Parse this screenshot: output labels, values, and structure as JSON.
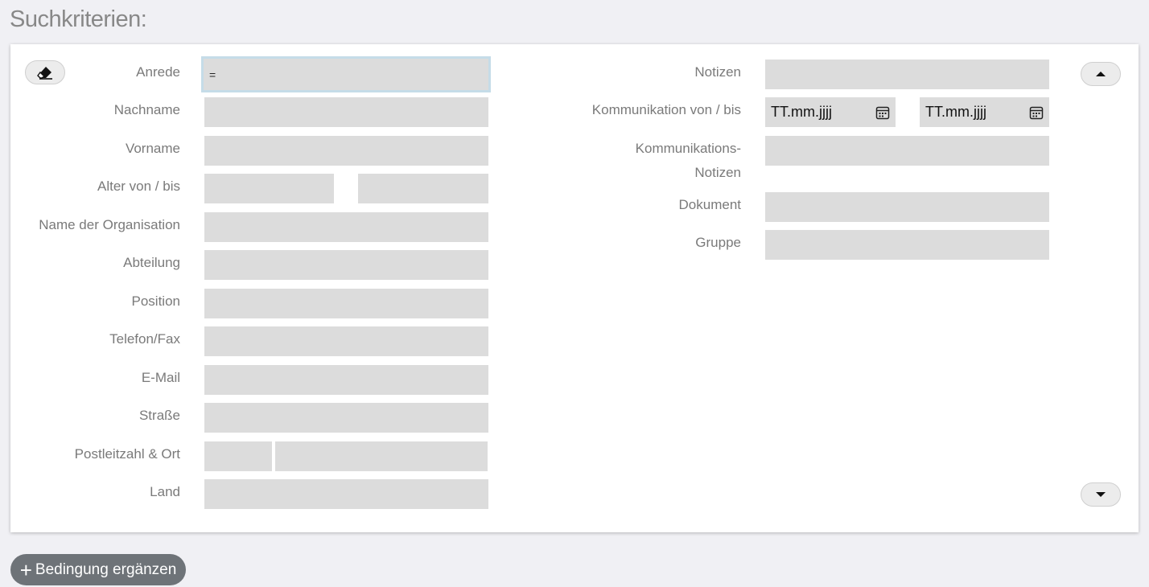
{
  "heading": "Suchkriterien:",
  "left": {
    "anrede_label": "Anrede",
    "anrede_value": "=",
    "nachname_label": "Nachname",
    "vorname_label": "Vorname",
    "alter_label": "Alter von / bis",
    "organisation_label": "Name der Organisation",
    "abteilung_label": "Abteilung",
    "position_label": "Position",
    "telefon_label": "Telefon/Fax",
    "email_label": "E-Mail",
    "strasse_label": "Straße",
    "plz_ort_label": "Postleitzahl & Ort",
    "land_label": "Land"
  },
  "right": {
    "notizen_label": "Notizen",
    "kommunikation_label": "Kommunikation von / bis",
    "date_from_placeholder": "TT.mm.jjjj",
    "date_to_placeholder": "TT.mm.jjjj",
    "komm_notizen_label_line1": "Kommunikations-",
    "komm_notizen_label_line2": "Notizen",
    "dokument_label": "Dokument",
    "gruppe_label": "Gruppe"
  },
  "buttons": {
    "add_condition_label": "Bedingung ergänzen"
  },
  "icons": {
    "clear": "eraser-icon",
    "up": "caret-up-icon",
    "down": "caret-down-icon",
    "calendar": "calendar-icon",
    "add": "plus-icon"
  }
}
